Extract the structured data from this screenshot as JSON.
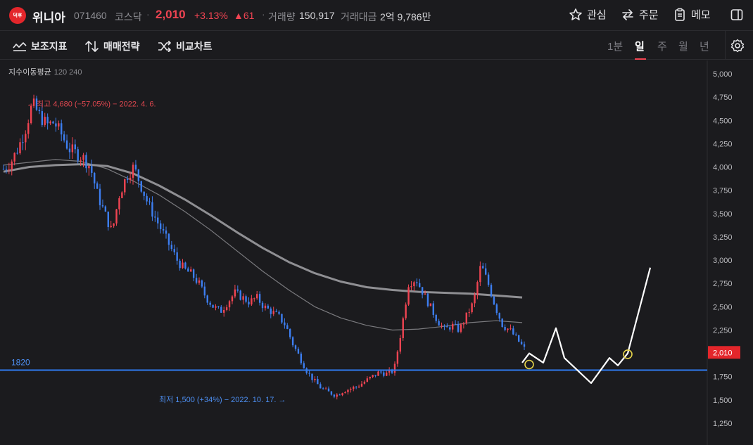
{
  "header": {
    "logo_text": "덕후",
    "name": "위니아",
    "code": "071460",
    "market": "코스닥",
    "separator": "·",
    "price": "2,010",
    "change_pct": "+3.13%",
    "change_abs": "▲61",
    "volume_label": "거래량",
    "volume_value": "150,917",
    "amount_label": "거래대금",
    "amount_value": "2억 9,786만",
    "actions": {
      "watch": "관심",
      "order": "주문",
      "memo": "메모"
    }
  },
  "toolbar": {
    "indicators": "보조지표",
    "strategy": "매매전략",
    "compare": "비교차트",
    "periods": [
      "1분",
      "일",
      "주",
      "월",
      "년"
    ],
    "active_period": "일"
  },
  "colors": {
    "up": "#f04452",
    "down": "#3d7ef0",
    "line_1820": "#2f7bf0",
    "ma120": "#7a7a7e",
    "ma240": "#8f8f93",
    "drawing": "#ffffff",
    "marker": "#e6d44a"
  },
  "chart_data": {
    "type": "candlestick",
    "indicator_label": "지수이동평균",
    "indicator_params": "120 240",
    "y_ticks": [
      5000,
      4750,
      4500,
      4250,
      4000,
      3750,
      3500,
      3250,
      3000,
      2750,
      2500,
      2250,
      2000,
      1750,
      1500,
      1250
    ],
    "y_tick_labels": [
      "5,000",
      "4,750",
      "4,500",
      "4,250",
      "4,000",
      "3,750",
      "3,500",
      "3,250",
      "3,000",
      "2,750",
      "2,500",
      "2,250",
      "2,000",
      "1,750",
      "1,500",
      "1,250"
    ],
    "ylim": [
      1100,
      5100
    ],
    "current_price": 2010,
    "current_price_label": "2,010",
    "horizontal_line": {
      "value": 1820,
      "label": "1820"
    },
    "high_annotation": {
      "text": "← 최고 4,680 (−57.05%) − 2022. 4. 6.",
      "value": 4680
    },
    "low_annotation": {
      "text": "최저 1,500 (+34%) − 2022. 10. 17. →",
      "value": 1500
    },
    "close_path": [
      3980,
      4050,
      4200,
      4400,
      4680,
      4550,
      4450,
      4480,
      4350,
      4200,
      4150,
      4100,
      4000,
      3700,
      3500,
      3300,
      3700,
      3900,
      4000,
      3800,
      3600,
      3450,
      3300,
      3150,
      3000,
      2900,
      2850,
      2750,
      2600,
      2500,
      2450,
      2550,
      2650,
      2600,
      2550,
      2600,
      2500,
      2450,
      2400,
      2300,
      2100,
      1950,
      1800,
      1700,
      1620,
      1580,
      1550,
      1600,
      1620,
      1650,
      1700,
      1750,
      1800,
      1780,
      1820,
      2250,
      2750,
      2800,
      2650,
      2500,
      2350,
      2250,
      2300,
      2250,
      2400,
      2550,
      2950,
      2750,
      2500,
      2300,
      2250,
      2150,
      2050
    ],
    "ma120": [
      4020,
      4050,
      4080,
      4060,
      3980,
      3850,
      3700,
      3520,
      3320,
      3100,
      2880,
      2680,
      2500,
      2380,
      2300,
      2250,
      2260,
      2290,
      2330,
      2350,
      2330
    ],
    "ma240": [
      3950,
      4000,
      4020,
      4030,
      4010,
      3930,
      3800,
      3650,
      3480,
      3300,
      3130,
      2980,
      2860,
      2770,
      2710,
      2680,
      2660,
      2650,
      2640,
      2620,
      2600
    ],
    "drawn_projection": [
      1900,
      2000,
      1900,
      2270,
      1950,
      1680,
      1950,
      1870,
      2000,
      2920
    ],
    "markers": [
      1880,
      1990
    ]
  }
}
